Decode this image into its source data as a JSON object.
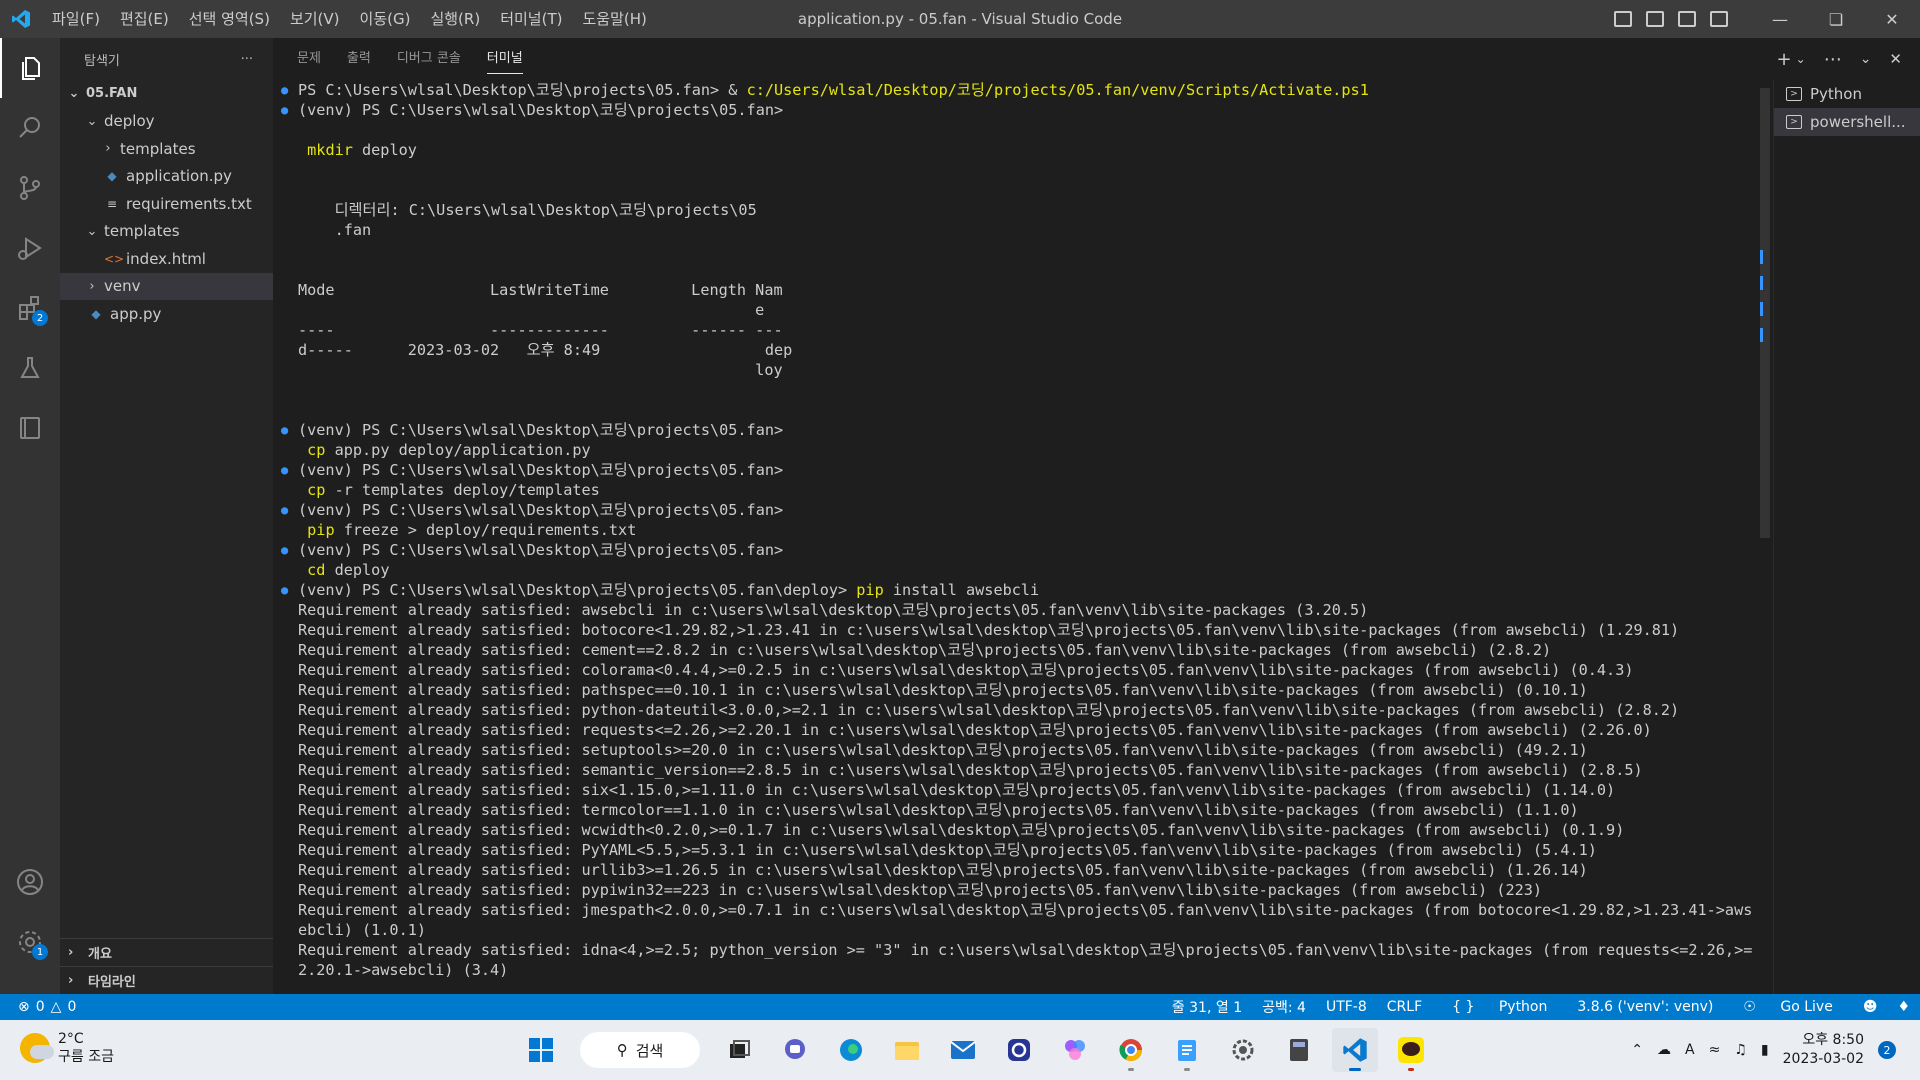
{
  "titlebar": {
    "menus": [
      "파일(F)",
      "편집(E)",
      "선택 영역(S)",
      "보기(V)",
      "이동(G)",
      "실행(R)",
      "터미널(T)",
      "도움말(H)"
    ],
    "title": "application.py - 05.fan - Visual Studio Code"
  },
  "activitybar": {
    "items": [
      "explorer-icon",
      "search-icon",
      "source-control-icon",
      "run-debug-icon",
      "extensions-icon",
      "testing-icon",
      "remote-icon"
    ],
    "extensions_badge": "2",
    "account_icon": "account-icon",
    "settings_icon": "gear-icon",
    "settings_badge": "1"
  },
  "sidebar": {
    "title": "탐색기",
    "more": "···",
    "root": "05.FAN",
    "tree": [
      {
        "label": "deploy",
        "type": "folder-open",
        "depth": 1
      },
      {
        "label": "templates",
        "type": "folder-closed",
        "depth": 2
      },
      {
        "label": "application.py",
        "type": "python",
        "depth": 2
      },
      {
        "label": "requirements.txt",
        "type": "text",
        "depth": 2
      },
      {
        "label": "templates",
        "type": "folder-open",
        "depth": 1
      },
      {
        "label": "index.html",
        "type": "html",
        "depth": 2
      },
      {
        "label": "venv",
        "type": "folder-closed",
        "depth": 1
      },
      {
        "label": "app.py",
        "type": "python",
        "depth": 1
      }
    ],
    "outline": "개요",
    "timeline": "타임라인"
  },
  "panel": {
    "tabs": [
      "문제",
      "출력",
      "디버그 콘솔",
      "터미널"
    ],
    "active_tab": "터미널",
    "terminals": [
      "Python",
      "powershell..."
    ]
  },
  "terminal": {
    "lines": [
      {
        "dot": true,
        "parts": [
          [
            "PS C:\\Users\\wlsal\\Desktop\\코딩\\projects\\05.fan> & ",
            ""
          ],
          [
            "c:/Users/wlsal/Desktop/코딩/projects/05.fan/venv/Scripts/Activate.ps1",
            "y"
          ]
        ]
      },
      {
        "dot": true,
        "parts": [
          [
            "(venv) PS C:\\Users\\wlsal\\Desktop\\코딩\\projects\\05.fan>",
            ""
          ]
        ]
      },
      {
        "dot": false,
        "parts": [
          [
            "",
            ""
          ]
        ]
      },
      {
        "dot": false,
        "parts": [
          [
            " ",
            ""
          ],
          [
            "mkdir",
            "y"
          ],
          [
            " deploy",
            ""
          ]
        ]
      },
      {
        "dot": false,
        "parts": [
          [
            "",
            ""
          ]
        ]
      },
      {
        "dot": false,
        "parts": [
          [
            "",
            ""
          ]
        ]
      },
      {
        "dot": false,
        "parts": [
          [
            "    디렉터리: C:\\Users\\wlsal\\Desktop\\코딩\\projects\\05",
            ""
          ]
        ]
      },
      {
        "dot": false,
        "parts": [
          [
            "    .fan",
            ""
          ]
        ]
      },
      {
        "dot": false,
        "parts": [
          [
            "",
            ""
          ]
        ]
      },
      {
        "dot": false,
        "parts": [
          [
            "",
            ""
          ]
        ]
      },
      {
        "dot": false,
        "parts": [
          [
            "Mode                 LastWriteTime         Length Nam",
            ""
          ]
        ]
      },
      {
        "dot": false,
        "parts": [
          [
            "                                                  e",
            ""
          ]
        ]
      },
      {
        "dot": false,
        "parts": [
          [
            "----                 -------------         ------ ---",
            ""
          ]
        ]
      },
      {
        "dot": false,
        "parts": [
          [
            "d-----      2023-03-02   오후 8:49                  dep",
            ""
          ]
        ]
      },
      {
        "dot": false,
        "parts": [
          [
            "                                                  loy",
            ""
          ]
        ]
      },
      {
        "dot": false,
        "parts": [
          [
            "",
            ""
          ]
        ]
      },
      {
        "dot": false,
        "parts": [
          [
            "",
            ""
          ]
        ]
      },
      {
        "dot": true,
        "parts": [
          [
            "(venv) PS C:\\Users\\wlsal\\Desktop\\코딩\\projects\\05.fan>",
            ""
          ]
        ]
      },
      {
        "dot": false,
        "parts": [
          [
            " ",
            ""
          ],
          [
            "cp",
            "y"
          ],
          [
            " app.py deploy/application.py",
            ""
          ]
        ]
      },
      {
        "dot": true,
        "parts": [
          [
            "(venv) PS C:\\Users\\wlsal\\Desktop\\코딩\\projects\\05.fan>",
            ""
          ]
        ]
      },
      {
        "dot": false,
        "parts": [
          [
            " ",
            ""
          ],
          [
            "cp",
            "y"
          ],
          [
            " -r templates deploy/templates",
            ""
          ]
        ]
      },
      {
        "dot": true,
        "parts": [
          [
            "(venv) PS C:\\Users\\wlsal\\Desktop\\코딩\\projects\\05.fan>",
            ""
          ]
        ]
      },
      {
        "dot": false,
        "parts": [
          [
            " ",
            ""
          ],
          [
            "pip",
            "y"
          ],
          [
            " freeze > deploy/requirements.txt",
            ""
          ]
        ]
      },
      {
        "dot": true,
        "parts": [
          [
            "(venv) PS C:\\Users\\wlsal\\Desktop\\코딩\\projects\\05.fan>",
            ""
          ]
        ]
      },
      {
        "dot": false,
        "parts": [
          [
            " ",
            ""
          ],
          [
            "cd",
            "y"
          ],
          [
            " deploy",
            ""
          ]
        ]
      },
      {
        "dot": true,
        "parts": [
          [
            "(venv) PS C:\\Users\\wlsal\\Desktop\\코딩\\projects\\05.fan\\deploy> ",
            ""
          ],
          [
            "pip",
            "y"
          ],
          [
            " install awsebcli",
            ""
          ]
        ]
      },
      {
        "dot": false,
        "parts": [
          [
            "Requirement already satisfied: awsebcli in c:\\users\\wlsal\\desktop\\코딩\\projects\\05.fan\\venv\\lib\\site-packages (3.20.5)",
            ""
          ]
        ]
      },
      {
        "dot": false,
        "parts": [
          [
            "Requirement already satisfied: botocore<1.29.82,>1.23.41 in c:\\users\\wlsal\\desktop\\코딩\\projects\\05.fan\\venv\\lib\\site-packages (from awsebcli) (1.29.81)",
            ""
          ]
        ]
      },
      {
        "dot": false,
        "parts": [
          [
            "Requirement already satisfied: cement==2.8.2 in c:\\users\\wlsal\\desktop\\코딩\\projects\\05.fan\\venv\\lib\\site-packages (from awsebcli) (2.8.2)",
            ""
          ]
        ]
      },
      {
        "dot": false,
        "parts": [
          [
            "Requirement already satisfied: colorama<0.4.4,>=0.2.5 in c:\\users\\wlsal\\desktop\\코딩\\projects\\05.fan\\venv\\lib\\site-packages (from awsebcli) (0.4.3)",
            ""
          ]
        ]
      },
      {
        "dot": false,
        "parts": [
          [
            "Requirement already satisfied: pathspec==0.10.1 in c:\\users\\wlsal\\desktop\\코딩\\projects\\05.fan\\venv\\lib\\site-packages (from awsebcli) (0.10.1)",
            ""
          ]
        ]
      },
      {
        "dot": false,
        "parts": [
          [
            "Requirement already satisfied: python-dateutil<3.0.0,>=2.1 in c:\\users\\wlsal\\desktop\\코딩\\projects\\05.fan\\venv\\lib\\site-packages (from awsebcli) (2.8.2)",
            ""
          ]
        ]
      },
      {
        "dot": false,
        "parts": [
          [
            "Requirement already satisfied: requests<=2.26,>=2.20.1 in c:\\users\\wlsal\\desktop\\코딩\\projects\\05.fan\\venv\\lib\\site-packages (from awsebcli) (2.26.0)",
            ""
          ]
        ]
      },
      {
        "dot": false,
        "parts": [
          [
            "Requirement already satisfied: setuptools>=20.0 in c:\\users\\wlsal\\desktop\\코딩\\projects\\05.fan\\venv\\lib\\site-packages (from awsebcli) (49.2.1)",
            ""
          ]
        ]
      },
      {
        "dot": false,
        "parts": [
          [
            "Requirement already satisfied: semantic_version==2.8.5 in c:\\users\\wlsal\\desktop\\코딩\\projects\\05.fan\\venv\\lib\\site-packages (from awsebcli) (2.8.5)",
            ""
          ]
        ]
      },
      {
        "dot": false,
        "parts": [
          [
            "Requirement already satisfied: six<1.15.0,>=1.11.0 in c:\\users\\wlsal\\desktop\\코딩\\projects\\05.fan\\venv\\lib\\site-packages (from awsebcli) (1.14.0)",
            ""
          ]
        ]
      },
      {
        "dot": false,
        "parts": [
          [
            "Requirement already satisfied: termcolor==1.1.0 in c:\\users\\wlsal\\desktop\\코딩\\projects\\05.fan\\venv\\lib\\site-packages (from awsebcli) (1.1.0)",
            ""
          ]
        ]
      },
      {
        "dot": false,
        "parts": [
          [
            "Requirement already satisfied: wcwidth<0.2.0,>=0.1.7 in c:\\users\\wlsal\\desktop\\코딩\\projects\\05.fan\\venv\\lib\\site-packages (from awsebcli) (0.1.9)",
            ""
          ]
        ]
      },
      {
        "dot": false,
        "parts": [
          [
            "Requirement already satisfied: PyYAML<5.5,>=5.3.1 in c:\\users\\wlsal\\desktop\\코딩\\projects\\05.fan\\venv\\lib\\site-packages (from awsebcli) (5.4.1)",
            ""
          ]
        ]
      },
      {
        "dot": false,
        "parts": [
          [
            "Requirement already satisfied: urllib3>=1.26.5 in c:\\users\\wlsal\\desktop\\코딩\\projects\\05.fan\\venv\\lib\\site-packages (from awsebcli) (1.26.14)",
            ""
          ]
        ]
      },
      {
        "dot": false,
        "parts": [
          [
            "Requirement already satisfied: pypiwin32==223 in c:\\users\\wlsal\\desktop\\코딩\\projects\\05.fan\\venv\\lib\\site-packages (from awsebcli) (223)",
            ""
          ]
        ]
      },
      {
        "dot": false,
        "parts": [
          [
            "Requirement already satisfied: jmespath<2.0.0,>=0.7.1 in c:\\users\\wlsal\\desktop\\코딩\\projects\\05.fan\\venv\\lib\\site-packages (from botocore<1.29.82,>1.23.41->aws",
            ""
          ]
        ]
      },
      {
        "dot": false,
        "parts": [
          [
            "ebcli) (1.0.1)",
            ""
          ]
        ]
      },
      {
        "dot": false,
        "parts": [
          [
            "Requirement already satisfied: idna<4,>=2.5; python_version >= \"3\" in c:\\users\\wlsal\\desktop\\코딩\\projects\\05.fan\\venv\\lib\\site-packages (from requests<=2.26,>=",
            ""
          ]
        ]
      },
      {
        "dot": false,
        "parts": [
          [
            "2.20.1->awsebcli) (3.4)",
            ""
          ]
        ]
      }
    ]
  },
  "statusbar": {
    "errors": "0",
    "warnings": "0",
    "position": "줄 31, 열 1",
    "spaces": "공백: 4",
    "encoding": "UTF-8",
    "eol": "CRLF",
    "language": "Python",
    "interpreter": "3.8.6 ('venv': venv)",
    "golive": "Go Live"
  },
  "taskbar": {
    "temperature": "2°C",
    "weather": "구름 조금",
    "search_label": "검색",
    "time": "오후 8:50",
    "date": "2023-03-02",
    "notifications": "2"
  },
  "colors": {
    "accent": "#007acc",
    "prompt_dot": "#3794ff",
    "command": "#e5e510"
  }
}
